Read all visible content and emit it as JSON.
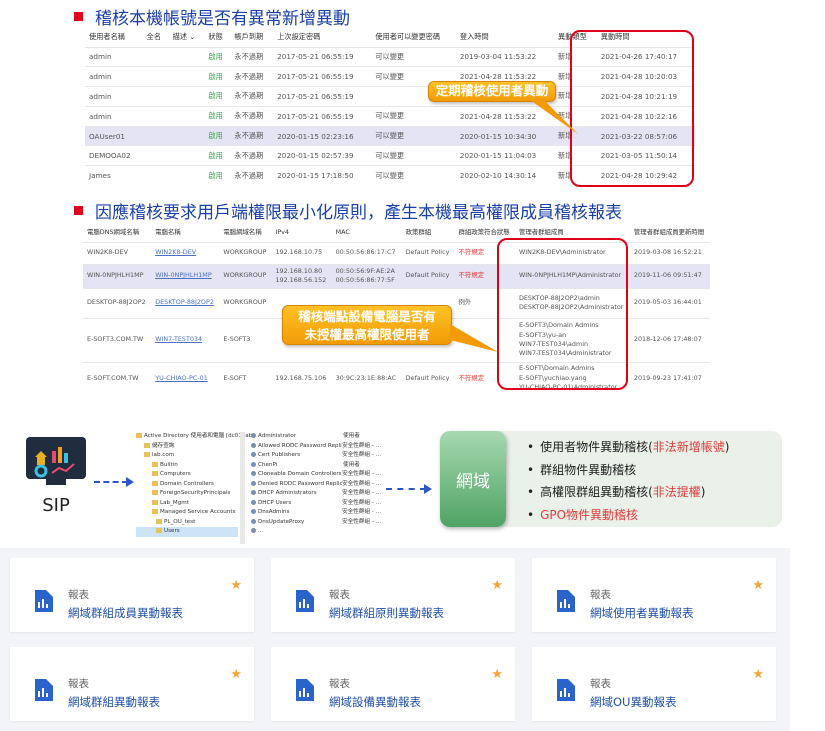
{
  "heading1": "稽核本機帳號是否有異常新增異動",
  "heading2": "因應稽核要求用戶端權限最小化原則，產生本機最高權限成員稽核報表",
  "table1": {
    "headers": [
      "使用者名稱",
      "全名",
      "描述 ⌄",
      "狀態",
      "帳戶到期",
      "上次設定密碼",
      "使用者可以變更密碼",
      "登入時間",
      "異動類型",
      "異動時間"
    ],
    "rows": [
      [
        "admin",
        "",
        "",
        "啟用",
        "永不過期",
        "2017-05-21 06:55:19",
        "可以變更",
        "2019-03-04 11:53:22",
        "新增",
        "2021-04-26 17:40:17"
      ],
      [
        "admin",
        "",
        "",
        "啟用",
        "永不過期",
        "2017-05-21 06:55:19",
        "可以變更",
        "2021-04-28 11:53:22",
        "新增",
        "2021-04-28 10:20:03"
      ],
      [
        "admin",
        "",
        "",
        "啟用",
        "永不過期",
        "2017-05-21 06:55:19",
        "",
        "",
        "新增",
        "2021-04-28 10:21:19"
      ],
      [
        "admin",
        "",
        "",
        "啟用",
        "永不過期",
        "2017-05-21 06:55:19",
        "可以變更",
        "2021-04-28 11:53:22",
        "新增",
        "2021-04-28 10:22:16"
      ],
      [
        "OAUser01",
        "",
        "",
        "啟用",
        "永不過期",
        "2020-01-15 02:23:16",
        "可以變更",
        "2020-01-15 10:34:30",
        "新增",
        "2021-03-22 08:57:06"
      ],
      [
        "DEMOOA02",
        "",
        "",
        "啟用",
        "永不過期",
        "2020-01-15 02:57:39",
        "可以變更",
        "2020-01-15 11:04:03",
        "新增",
        "2021-03-05 11:50:14"
      ],
      [
        "James",
        "",
        "",
        "啟用",
        "永不過期",
        "2020-01-15 17:18:50",
        "可以變更",
        "2020-02-10 14:30:14",
        "新增",
        "2021-04-28 10:29:42"
      ]
    ]
  },
  "callout1": "定期稽核使用者異動",
  "table2": {
    "headers": [
      "電腦DNS網域名稱",
      "電腦名稱",
      "電腦網域名稱",
      "IPv4",
      "MAC",
      "政策群組",
      "群組政策符合狀態",
      "管理者群組成員",
      "管理者群組成員更新時間"
    ],
    "rows": [
      [
        "WIN2K8-DEV",
        "WIN2K8-DEV",
        "WORKGROUP",
        "192.168.10.75",
        "00:50:56:86:17:C7",
        "Default Policy",
        "不符規定",
        "WIN2K8-DEV\\Administrator",
        "2019-03-08 16:52:21"
      ],
      [
        "WIN-0NPJHLH1MP",
        "WIN-0NPJHLH1MP",
        "WORKGROUP",
        "192.168.10.80\n192.168.56.152",
        "00:50:56:9F:AE:2A\n00:50:56:86:77:5F",
        "Default Policy",
        "不符規定",
        "WIN-0NPJHLH1MP\\Administrator",
        "2019-11-06 09:51:47"
      ],
      [
        "DESKTOP-88J2OP2",
        "DESKTOP-88J2OP2",
        "WORKGROUP",
        "",
        "",
        "",
        "例外",
        "DESKTOP-88J2OP2\\admin\nDESKTOP-88J2OP2\\Administrator",
        "2019-05-03 16:44:01"
      ],
      [
        "E-SOFT3.COM.TW",
        "WIN7-TEST034",
        "E-SOFT3",
        "",
        "",
        "",
        "",
        "E-SOFT3\\Domain Admins\nE-SOFT3\\yu-an\nWIN7-TEST034\\admin\nWIN7-TEST034\\Administrator",
        "2018-12-06 17:48:07"
      ],
      [
        "E-SOFT.COM.TW",
        "YU-CHIAO-PC-01",
        "E-SOFT",
        "192.168.75.106",
        "30:9C:23:1E:88:AC",
        "Default Policy",
        "不符規定",
        "E-SOFT\\Domain Admins\nE-SOFT\\yuchiao.yang\nYU-CHIAO-PC-01\\Administrator",
        "2019-09-23 17:41:07"
      ]
    ]
  },
  "callout2": "稽核端點設備電腦是否有\n未授權最高權限使用者",
  "sip_label": "SIP",
  "ad_tree": [
    "Active Directory 使用者和電腦 [dc01.lab.",
    "儲存查詢",
    "lab.com",
    "Builtin",
    "Computers",
    "Domain Controllers",
    "ForeignSecurityPrincipals",
    "Lab_Mgmt",
    "Managed Service Accounts",
    "PL_OU_test",
    "Users"
  ],
  "ad_list": [
    {
      "name": "Administrator",
      "type": "使用者"
    },
    {
      "name": "Allowed RODC Password Replication ...",
      "type": "安全性群組 - ..."
    },
    {
      "name": "Cert Publishers",
      "type": "安全性群組 - ..."
    },
    {
      "name": "ChenPi",
      "type": "使用者"
    },
    {
      "name": "Cloneable Domain Controllers",
      "type": "安全性群組 - ..."
    },
    {
      "name": "Denied RODC Password Replication G...",
      "type": "安全性群組 - ..."
    },
    {
      "name": "DHCP Administrators",
      "type": "安全性群組 - ..."
    },
    {
      "name": "DHCP Users",
      "type": "安全性群組 - ..."
    },
    {
      "name": "DnsAdmins",
      "type": "安全性群組 - ..."
    },
    {
      "name": "DnsUpdateProxy",
      "type": "安全性群組 - ..."
    },
    {
      "name": "...",
      "type": ""
    }
  ],
  "domain_label": "網域",
  "bullets": [
    {
      "text": "使用者物件異動稽核(",
      "red": "非法新增帳號",
      "tail": ")"
    },
    {
      "text": "群組物件異動稽核",
      "red": "",
      "tail": ""
    },
    {
      "text": "高權限群組異動稽核(",
      "red": "非法提權",
      "tail": ")"
    },
    {
      "text": "",
      "red": "GPO物件異動稽核",
      "tail": ""
    }
  ],
  "cards": [
    {
      "category": "報表",
      "title": "網域群組成員異動報表"
    },
    {
      "category": "報表",
      "title": "網域群組原則異動報表"
    },
    {
      "category": "報表",
      "title": "網域使用者異動報表"
    },
    {
      "category": "報表",
      "title": "網域群組異動報表"
    },
    {
      "category": "報表",
      "title": "網域設備異動報表"
    },
    {
      "category": "報表",
      "title": "網域OU異動報表"
    }
  ],
  "colors": {
    "heading": "#1a3fa8",
    "bullet": "#e0001b",
    "accent_green": "#3aa64a",
    "warn_red": "#e23b3b",
    "callout": "#f29b06",
    "star": "#f2a53d",
    "card_title": "#1f4fa8"
  }
}
